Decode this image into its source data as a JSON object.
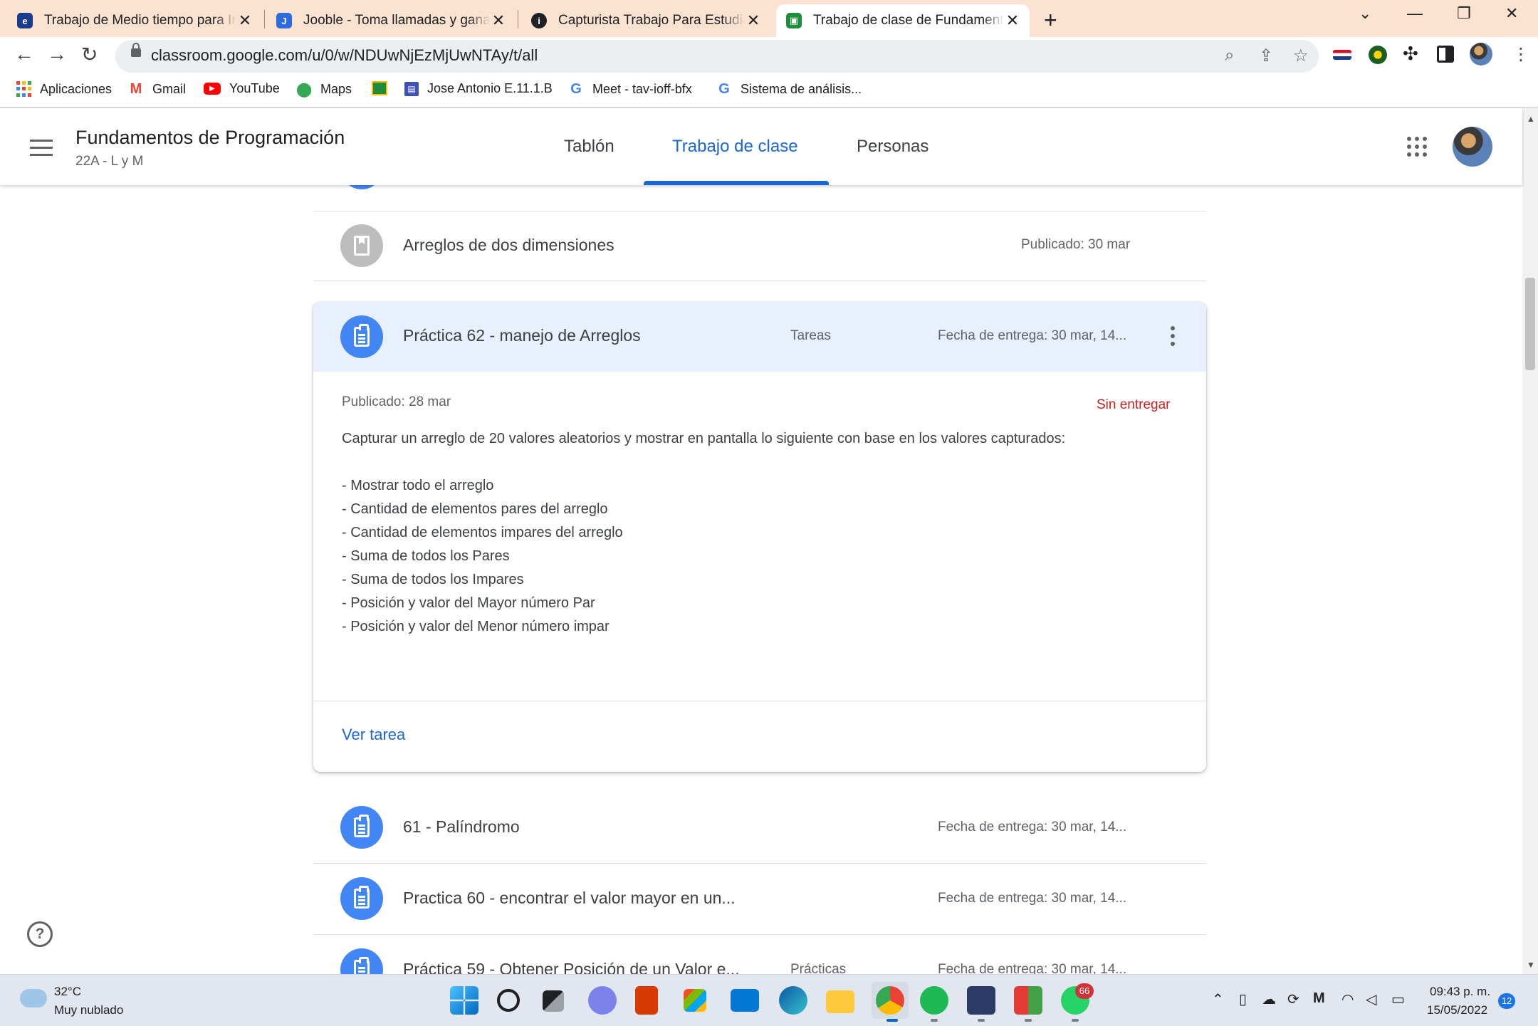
{
  "browser": {
    "tabs": [
      {
        "title": "Trabajo de Medio tiempo para Ing",
        "icon": "jobs-favicon-icon",
        "color": "#1a3c8c"
      },
      {
        "title": "Jooble - Toma llamadas y gana d",
        "icon": "jooble-favicon-icon",
        "color": "#2d6cdf"
      },
      {
        "title": "Capturista Trabajo Para Estudiant",
        "icon": "indeed-favicon-icon",
        "color": "#202124"
      },
      {
        "title": "Trabajo de clase de Fundamentos",
        "icon": "classroom-favicon-icon",
        "color": "#1e8e3e"
      }
    ],
    "url": "classroom.google.com/u/0/w/NDUwNjEzMjUwNTAy/t/all",
    "bookmarks": [
      {
        "label": "Aplicaciones",
        "icon": "apps-grid-icon"
      },
      {
        "label": "Gmail",
        "icon": "gmail-icon"
      },
      {
        "label": "YouTube",
        "icon": "youtube-icon"
      },
      {
        "label": "Maps",
        "icon": "maps-pin-icon"
      },
      {
        "label": "",
        "icon": "classroom-bookmark-icon"
      },
      {
        "label": "Jose Antonio E.11.1.B",
        "icon": "forms-icon"
      },
      {
        "label": "Meet - tav-ioff-bfx",
        "icon": "google-g-icon"
      },
      {
        "label": "Sistema de análisis...",
        "icon": "google-g-icon"
      }
    ]
  },
  "classroom": {
    "course_title": "Fundamentos de Programación",
    "course_section": "22A - L y M",
    "nav_tabs": [
      "Tablón",
      "Trabajo de clase",
      "Personas"
    ],
    "active_tab": "Trabajo de clase",
    "accent_color": "#1967d2"
  },
  "items": {
    "material": {
      "title": "Arreglos de dos dimensiones",
      "date": "Publicado: 30 mar"
    },
    "expanded": {
      "title": "Práctica 62 - manejo de Arreglos",
      "topic": "Tareas",
      "due": "Fecha de entrega: 30 mar, 14...",
      "published": "Publicado: 28 mar",
      "status": "Sin entregar",
      "description": [
        "Capturar un arreglo de 20 valores aleatorios y mostrar en pantalla lo siguiente con base en los valores capturados:",
        "",
        "- Mostrar todo el arreglo",
        "- Cantidad de elementos pares del arreglo",
        "- Cantidad de elementos impares del arreglo",
        "- Suma de todos los Pares",
        "- Suma de todos los Impares",
        "- Posición y valor del Mayor número Par",
        "- Posición y valor del Menor número impar"
      ],
      "view_label": "Ver tarea"
    },
    "list": [
      {
        "title": "61 - Palíndromo",
        "topic": "",
        "due": "Fecha de entrega: 30 mar, 14..."
      },
      {
        "title": "Practica 60 - encontrar el valor mayor en un...",
        "topic": "",
        "due": "Fecha de entrega: 30 mar, 14..."
      },
      {
        "title": "Práctica 59 - Obtener Posición de un Valor e...",
        "topic": "Prácticas",
        "due": "Fecha de entrega: 30 mar, 14..."
      }
    ]
  },
  "taskbar": {
    "weather_temp": "32°C",
    "weather_desc": "Muy nublado",
    "time": "09:43 p. m.",
    "date": "15/05/2022",
    "whatsapp_badge": "66",
    "notifications": "12"
  }
}
